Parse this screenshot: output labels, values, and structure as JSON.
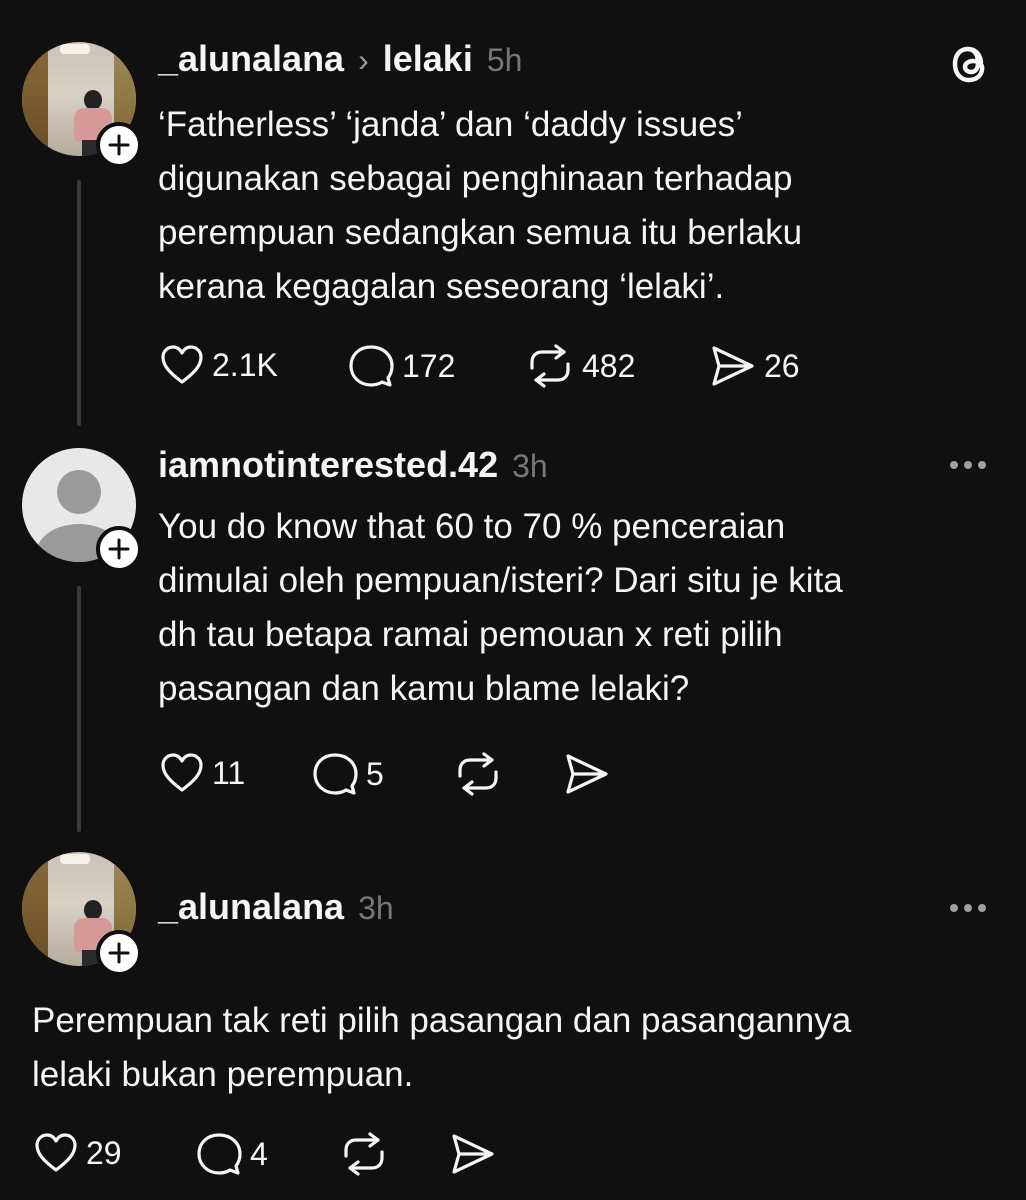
{
  "post1": {
    "username": "_alunalana",
    "separator": "›",
    "topic": "lelaki",
    "time": "5h",
    "text": "‘Fatherless’ ‘janda’ dan ‘daddy issues’\ndigunakan sebagai penghinaan terhadap\nperempuan sedangkan semua itu berlaku\nkerana kegagalan seseorang ‘lelaki’.",
    "likes": "2.1K",
    "replies": "172",
    "reposts": "482",
    "shares": "26"
  },
  "post2": {
    "username": "iamnotinterested.42",
    "time": "3h",
    "text": "You do know that 60 to 70 % penceraian\ndimulai oleh pempuan/isteri? Dari situ je kita\ndh tau betapa ramai pemouan x reti pilih\npasangan dan kamu blame lelaki?",
    "likes": "11",
    "replies": "5"
  },
  "post3": {
    "username": "_alunalana",
    "time": "3h",
    "text": "Perempuan tak reti pilih pasangan dan pasangannya\nlelaki bukan perempuan.",
    "likes": "29",
    "replies": "4"
  },
  "icons": {
    "threads_logo": "threads-logo-icon",
    "like": "heart-icon",
    "reply": "comment-icon",
    "repost": "repost-icon",
    "share": "send-icon",
    "more": "more-options-icon",
    "follow": "plus-icon"
  }
}
